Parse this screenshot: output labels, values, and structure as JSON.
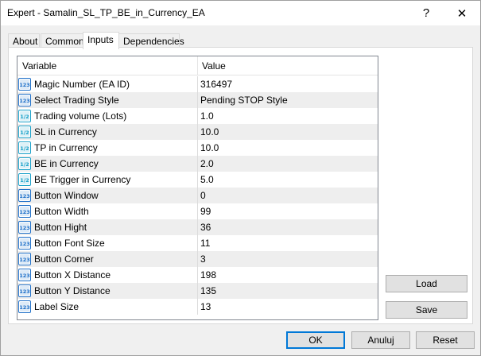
{
  "window": {
    "title": "Expert - Samalin_SL_TP_BE_in_Currency_EA",
    "help_glyph": "?",
    "close_glyph": "✕"
  },
  "tabs": [
    {
      "label": "About"
    },
    {
      "label": "Common"
    },
    {
      "label": "Inputs",
      "active": true
    },
    {
      "label": "Dependencies"
    }
  ],
  "grid": {
    "headers": {
      "variable": "Variable",
      "value": "Value"
    },
    "rows": [
      {
        "icon": "integer-icon",
        "variable": "Magic Number (EA ID)",
        "value": "316497"
      },
      {
        "icon": "integer-icon",
        "variable": "Select Trading Style",
        "value": "Pending STOP Style"
      },
      {
        "icon": "double-icon",
        "variable": "Trading volume (Lots)",
        "value": "1.0"
      },
      {
        "icon": "double-icon",
        "variable": "SL in Currency",
        "value": "10.0"
      },
      {
        "icon": "double-icon",
        "variable": "TP in Currency",
        "value": "10.0"
      },
      {
        "icon": "double-icon",
        "variable": "BE in Currency",
        "value": "2.0"
      },
      {
        "icon": "double-icon",
        "variable": "BE Trigger in Currency",
        "value": "5.0"
      },
      {
        "icon": "integer-icon",
        "variable": "Button Window",
        "value": "0"
      },
      {
        "icon": "integer-icon",
        "variable": "Button Width",
        "value": "99"
      },
      {
        "icon": "integer-icon",
        "variable": "Button Hight",
        "value": "36"
      },
      {
        "icon": "integer-icon",
        "variable": "Button Font Size",
        "value": "11"
      },
      {
        "icon": "integer-icon",
        "variable": "Button Corner",
        "value": "3"
      },
      {
        "icon": "integer-icon",
        "variable": "Button X Distance",
        "value": "198"
      },
      {
        "icon": "integer-icon",
        "variable": "Button Y Distance",
        "value": "135"
      },
      {
        "icon": "integer-icon",
        "variable": "Label Size",
        "value": "13"
      }
    ]
  },
  "icon_text": {
    "integer": "123",
    "double": "1/2"
  },
  "side_buttons": {
    "load": "Load",
    "save": "Save"
  },
  "footer_buttons": {
    "ok": "OK",
    "cancel": "Anuluj",
    "reset": "Reset"
  },
  "colors": {
    "accent": "#0078d7",
    "icon_blue": "#1e6fc8",
    "icon_teal": "#18a0c8"
  }
}
